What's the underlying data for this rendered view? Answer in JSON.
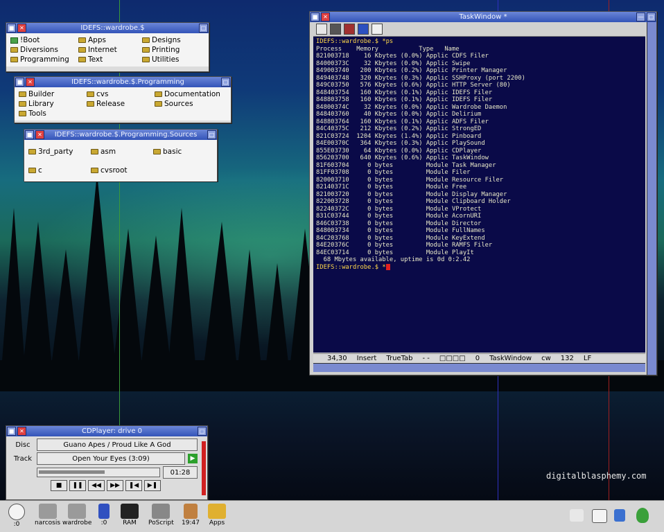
{
  "desktop": {
    "watermark": "digitalblasphemy.com"
  },
  "win_root": {
    "title": "IDEFS::wardrobe.$",
    "items": [
      "!Boot",
      "Apps",
      "Designs",
      "Diversions",
      "Internet",
      "Printing",
      "Programming",
      "Text",
      "Utilities"
    ]
  },
  "win_prog": {
    "title": "IDEFS::wardrobe.$.Programming",
    "items": [
      "Builder",
      "cvs",
      "Documentation",
      "Library",
      "Release",
      "Sources",
      "Tools"
    ]
  },
  "win_src": {
    "title": "IDEFS::wardrobe.$.Programming.Sources",
    "items": [
      "3rd_party",
      "asm",
      "basic",
      "c",
      "cvsroot"
    ]
  },
  "task": {
    "title": "TaskWindow *",
    "prompt": "IDEFS::wardrobe.$ *ps",
    "header": "Process    Memory           Type   Name",
    "lines": [
      "821003718    16 Kbytes (0.0%) Applic CDFS Filer",
      "84000373C    32 Kbytes (0.0%) Applic Swipe",
      "849003740   200 Kbytes (0.2%) Applic Printer Manager",
      "849403748   320 Kbytes (0.3%) Applic SSHProxy (port 2200)",
      "849C03750   576 Kbytes (0.6%) Applic HTTP Server (80)",
      "848403754   160 Kbytes (0.1%) Applic IDEFS Filer",
      "848803758   160 Kbytes (0.1%) Applic IDEFS Filer",
      "84800374C    32 Kbytes (0.0%) Applic Wardrobe Daemon",
      "848403760    40 Kbytes (0.0%) Applic Delirium",
      "848803764   160 Kbytes (0.1%) Applic ADFS Filer",
      "84C40375C   212 Kbytes (0.2%) Applic StrongED",
      "821C03724  1204 Kbytes (1.4%) Applic Pinboard",
      "84E00370C   364 Kbytes (0.3%) Applic PlaySound",
      "855E03730    64 Kbytes (0.0%) Applic CDPlayer",
      "856203700   640 Kbytes (0.6%) Applic TaskWindow",
      "81F603704     0 bytes         Module Task Manager",
      "81FF03708     0 bytes         Module Filer",
      "820003710     0 bytes         Module Resource Filer",
      "82140371C     0 bytes         Module Free",
      "821003720     0 bytes         Module Display Manager",
      "822003728     0 bytes         Module Clipboard Holder",
      "82240372C     0 bytes         Module VProtect",
      "831C03744     0 bytes         Module AcornURI",
      "846C03738     0 bytes         Module Director",
      "848003734     0 bytes         Module FullNames",
      "84C203768     0 bytes         Module KeyExtend",
      "84E20376C     0 bytes         Module RAMFS Filer",
      "84EC03714     0 bytes         Module PlayIt"
    ],
    "footer": "  68 Mbytes available, uptime is 0d 0:2.42",
    "prompt2": "IDEFS::wardrobe.$ *",
    "status": {
      "pos": "34,30",
      "mode": "Insert",
      "tab": "TrueTab",
      "dashes": "- -",
      "count": "0",
      "name": "TaskWindow",
      "cw": "cw",
      "col": "132",
      "eol": "LF"
    }
  },
  "cd": {
    "title": "CDPlayer: drive 0",
    "disc_label": "Disc",
    "disc_value": "Guano Apes / Proud Like A God",
    "track_label": "Track",
    "track_value": "Open Your Eyes (3:09)",
    "time": "01:28",
    "progress": 0.55,
    "buttons": [
      "■",
      "❚❚",
      "◀◀",
      "▶▶",
      "❚◀",
      "▶❚"
    ]
  },
  "iconbar": {
    "left": [
      ":0",
      "narcosis",
      "wardrobe",
      ":0",
      "RAM",
      "PoScript",
      "19:47",
      "Apps"
    ]
  }
}
